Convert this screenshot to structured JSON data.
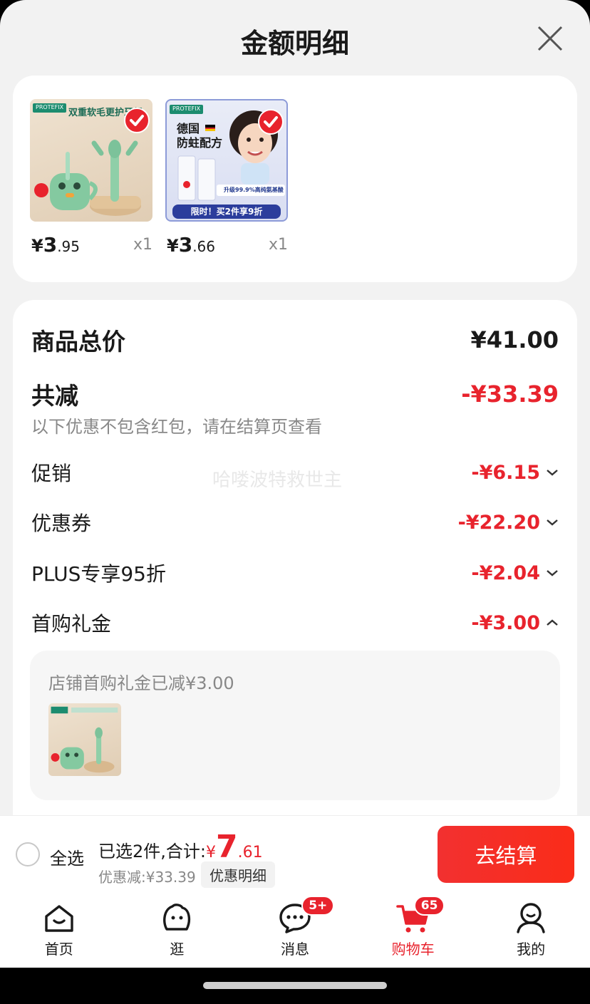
{
  "header": {
    "title": "金额明细"
  },
  "products": [
    {
      "price_yen": "¥",
      "price_int": "3",
      "price_dec": ".95",
      "qty": "x1",
      "brand": "PROTEFIX",
      "caption": "双重软毛更护牙龈"
    },
    {
      "price_yen": "¥",
      "price_int": "3",
      "price_dec": ".66",
      "qty": "x1",
      "brand": "PROTEFIX",
      "caption_line1": "德国",
      "caption_line2": "防蛀配方",
      "promo_banner": "限时！买2件享9折",
      "upgrade_text": "升级99.9%高纯氨基酸"
    }
  ],
  "summary": {
    "total_label": "商品总价",
    "total_amount": "¥41.00",
    "reduce_label": "共减",
    "reduce_amount": "-¥33.39",
    "note": "以下优惠不包含红包，请在结算页查看",
    "watermark": "哈喽波特救世主",
    "items": [
      {
        "label": "促销",
        "amount": "-¥6.15",
        "expanded": false
      },
      {
        "label": "优惠券",
        "amount": "-¥22.20",
        "expanded": false
      },
      {
        "label": "PLUS专享95折",
        "amount": "-¥2.04",
        "expanded": false
      },
      {
        "label": "首购礼金",
        "amount": "-¥3.00",
        "expanded": true
      }
    ],
    "detail_text": "店铺首购礼金已减¥3.00"
  },
  "cart_bar": {
    "select_all": "全选",
    "selected_prefix": "已选2件,合计:",
    "total_yen": "¥",
    "total_int": "7",
    "total_dec": ".61",
    "discount_text": "优惠减:¥33.39",
    "detail_button": "优惠明细",
    "checkout_button": "去结算"
  },
  "tabbar": {
    "tabs": [
      {
        "label": "首页",
        "icon": "home-icon"
      },
      {
        "label": "逛",
        "icon": "browse-icon"
      },
      {
        "label": "消息",
        "icon": "message-icon",
        "badge": "5+"
      },
      {
        "label": "购物车",
        "icon": "cart-icon",
        "badge": "65",
        "active": true
      },
      {
        "label": "我的",
        "icon": "profile-icon"
      }
    ]
  },
  "colors": {
    "accent": "#e8232d",
    "brand_green": "#1c8c6f"
  }
}
